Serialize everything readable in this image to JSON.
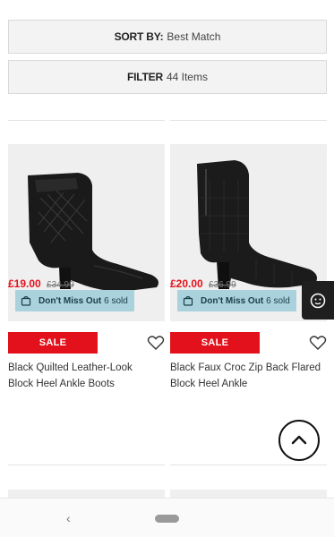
{
  "sort": {
    "label": "SORT BY:",
    "value": "Best Match"
  },
  "filter": {
    "label": "FILTER",
    "count": "44 Items"
  },
  "products": [
    {
      "promo_bold": "Don't Miss Out",
      "promo_sold": "6 sold",
      "sale_badge": "SALE",
      "title": "Black Quilted Leather-Look Block Heel Ankle Boots",
      "price_now": "£19.00",
      "price_was": "£34.99"
    },
    {
      "promo_bold": "Don't Miss Out",
      "promo_sold": "6 sold",
      "sale_badge": "SALE",
      "title": "Black Faux Croc Zip Back Flared Block Heel Ankle",
      "price_now": "£20.00",
      "price_was": "£36.99"
    }
  ],
  "colors": {
    "sale_red": "#e3111b",
    "promo_blue": "#a9d2dc"
  },
  "icons": [
    "bag-icon",
    "heart-icon",
    "feedback-icon",
    "chevron-up-icon",
    "back-icon",
    "home-pill-icon"
  ]
}
